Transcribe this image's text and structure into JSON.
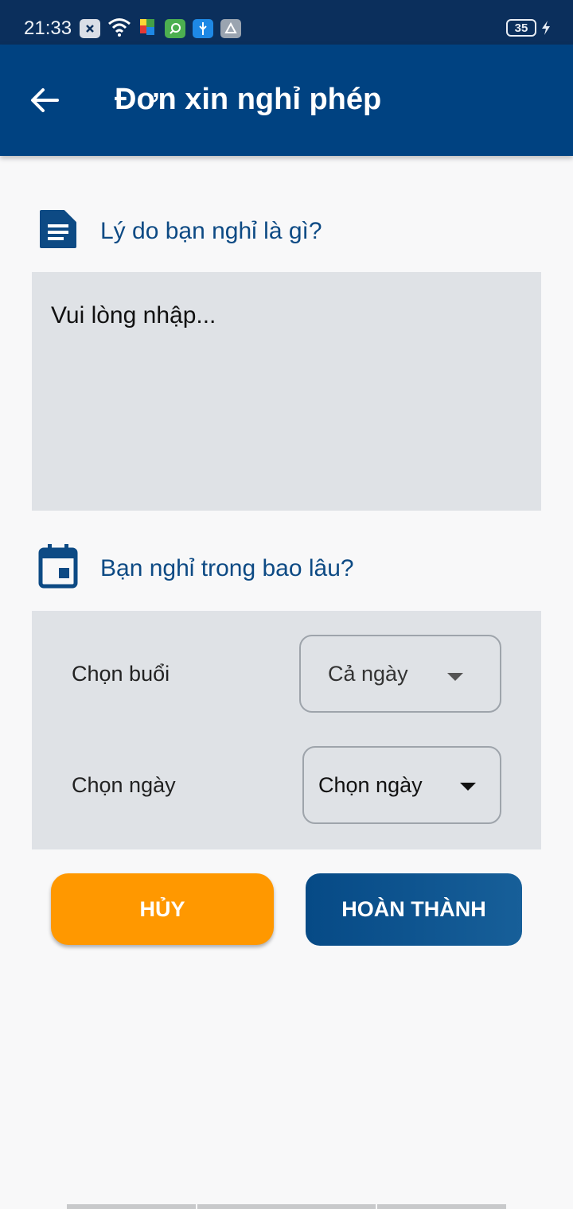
{
  "status_bar": {
    "time": "21:33",
    "battery": "35"
  },
  "app_bar": {
    "title": "Đơn xin nghỉ phép"
  },
  "reason_section": {
    "label": "Lý do bạn nghỉ là gì?",
    "placeholder": "Vui lòng nhập..."
  },
  "duration_section": {
    "label": "Bạn nghỉ trong bao lâu?",
    "session_label": "Chọn buổi",
    "session_value": "Cả ngày",
    "date_label": "Chọn ngày",
    "date_value": "Chọn ngày"
  },
  "actions": {
    "cancel": "HỦY",
    "done": "HOÀN THÀNH"
  },
  "colors": {
    "primary": "#004281",
    "accent": "#ff9800",
    "box": "#dfe2e6",
    "label": "#0d4a84"
  }
}
